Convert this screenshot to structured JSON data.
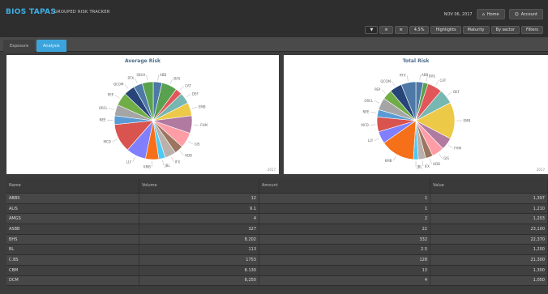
{
  "header": {
    "brand": "BIOS TAPAS",
    "subtitle": "GROUPED RISK TRACKER",
    "date": "NOV 06, 2017",
    "button_1": "Home",
    "button_2": "Account"
  },
  "toolbar": [
    "▼",
    "≡",
    "≡",
    "4.5%",
    "Highlights",
    "Maturity",
    "By sector",
    "Filters"
  ],
  "tabs": [
    "Exposure",
    "Analysis"
  ],
  "colors": [
    "#4e79a7",
    "#59a14f",
    "#e15759",
    "#76b7b2",
    "#edc948",
    "#b07aa1",
    "#ff9da7",
    "#9c755f",
    "#bab0ac",
    "#4dc9f6",
    "#f67019",
    "#7f7fff",
    "#d9534f",
    "#5b9bd5",
    "#a5a5a5",
    "#70ad47",
    "#264478"
  ],
  "charts": [
    {
      "title": "Average Risk",
      "footer": "2017",
      "labels": [
        "ABB",
        "BAS",
        "CAT",
        "DEF",
        "EMB",
        "FHM",
        "GIS",
        "HDB",
        "IFX",
        "JBL",
        "KMB",
        "LLY",
        "MCD",
        "NEE",
        "ORCL",
        "PEP",
        "QCOM",
        "RTX",
        "SBUX"
      ],
      "values": [
        4,
        7,
        3,
        5,
        6,
        8,
        7,
        4,
        5,
        3,
        6,
        9,
        13,
        4,
        5,
        6,
        5,
        4,
        5
      ]
    },
    {
      "title": "Total Risk",
      "footer": "2017",
      "labels": [
        "ABB",
        "BAS",
        "CAT",
        "DEF",
        "EMB",
        "FHM",
        "GIS",
        "HDB",
        "IFX",
        "JBL",
        "KMB",
        "LLY",
        "MCD",
        "NEE",
        "ORCL",
        "PEP",
        "QCOM",
        "RTX"
      ],
      "values": [
        3,
        2,
        6,
        6,
        15,
        5,
        5,
        3,
        3,
        2,
        14,
        5,
        6,
        3,
        5,
        4,
        5,
        6
      ]
    }
  ],
  "table": {
    "headers": [
      "Name",
      "Volume",
      "Amount",
      "Value"
    ],
    "rows": [
      [
        "ABBS",
        "12",
        "1",
        "1,397"
      ],
      [
        "ALIS",
        "9.1",
        "1",
        "1,210"
      ],
      [
        "AMGS",
        "4",
        "2",
        "1,203"
      ],
      [
        "ASBB",
        "327",
        "22",
        "23,100"
      ],
      [
        "BHS",
        "8.202",
        "332",
        "22,370"
      ],
      [
        "BL",
        "113",
        "2.5",
        "1,200"
      ],
      [
        "C.BS",
        "1753",
        "128",
        "21,300"
      ],
      [
        "CBM",
        "8.130",
        "13",
        "1,300"
      ],
      [
        "DCM",
        "8,250",
        "4",
        "1,050"
      ]
    ]
  }
}
